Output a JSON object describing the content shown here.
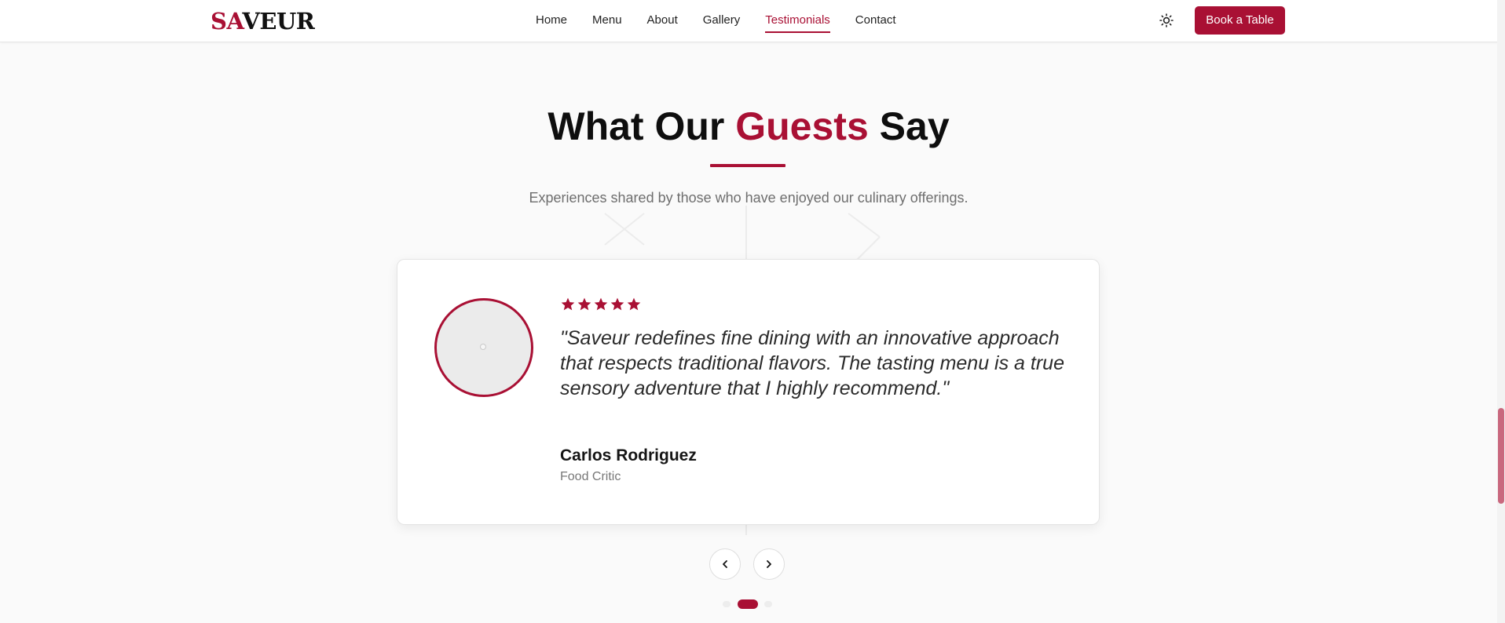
{
  "header": {
    "logo": {
      "accent": "SA",
      "rest": "VEUR"
    },
    "nav": [
      {
        "label": "Home"
      },
      {
        "label": "Menu"
      },
      {
        "label": "About"
      },
      {
        "label": "Gallery"
      },
      {
        "label": "Testimonials",
        "active": true
      },
      {
        "label": "Contact"
      }
    ],
    "theme_icon": "sun-icon",
    "cta_label": "Book a Table"
  },
  "testimonials": {
    "title_before": "What Our ",
    "title_accent": "Guests",
    "title_after": " Say",
    "subtitle": "Experiences shared by those who have enjoyed our culinary offerings.",
    "active_card": {
      "rating": 5,
      "quote": "\"Saveur redefines fine dining with an innovative approach that respects traditional flavors. The tasting menu is a true sensory adventure that I highly recommend.\"",
      "author": "Carlos Rodriguez",
      "role": "Food Critic"
    },
    "controls": {
      "prev_icon": "chevron-left-icon",
      "next_icon": "chevron-right-icon",
      "slide_count": 3,
      "active_slide": 2
    }
  },
  "colors": {
    "accent": "#a91034",
    "background": "#fafafa",
    "card": "#ffffff",
    "muted_text": "#6e6e6e"
  }
}
